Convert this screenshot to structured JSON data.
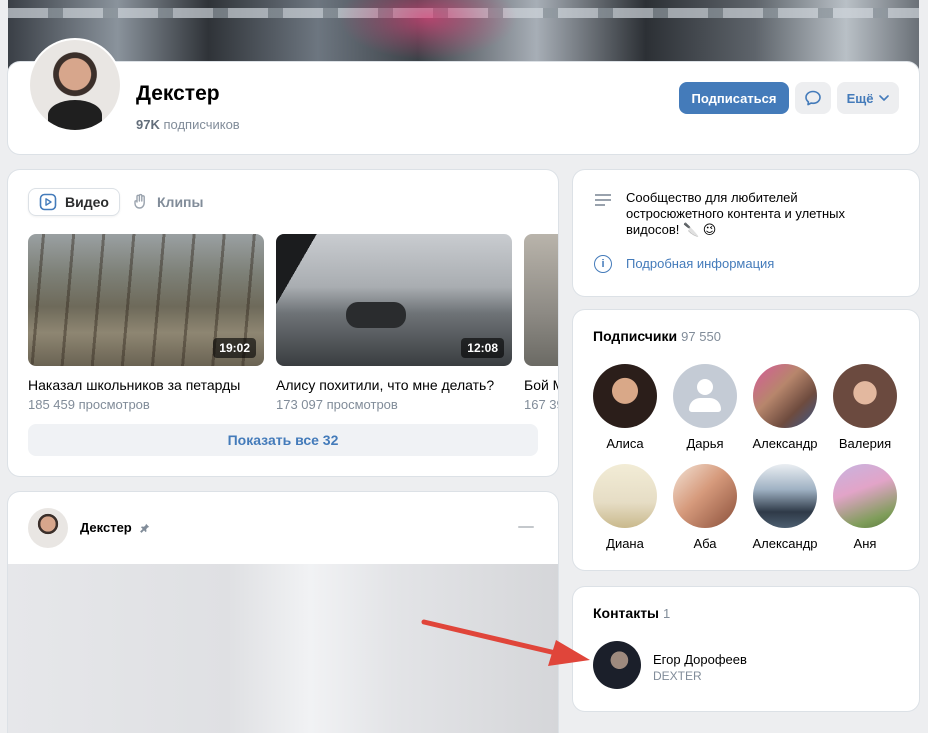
{
  "colors": {
    "accent": "#447bba",
    "secondary_text": "#818c99",
    "arrow": "#e0453a"
  },
  "header": {
    "group_name": "Декстер",
    "subscribers_short": "97K",
    "subscribers_word": "подписчиков",
    "subscribe_button": "Подписаться",
    "more_button": "Ещё"
  },
  "videos_block": {
    "tabs": [
      {
        "label": "Видео",
        "icon": "play-icon",
        "active": true
      },
      {
        "label": "Клипы",
        "icon": "clips-icon",
        "active": false
      }
    ],
    "items": [
      {
        "title": "Наказал школьников за петарды",
        "views": "185 459 просмотров",
        "duration": "19:02"
      },
      {
        "title": "Алису похитили, что мне делать?",
        "views": "173 097 просмотров",
        "duration": "12:08"
      },
      {
        "title": "Бой М",
        "views": "167 39",
        "duration": ""
      }
    ],
    "show_all": "Показать все 32"
  },
  "post": {
    "author": "Декстер",
    "pinned_icon": "pin-icon"
  },
  "description": {
    "text": "Сообщество для любителей остросюжетного контента и улетных видосов! 🔪 😉",
    "more_info_link": "Подробная информация"
  },
  "subscribers_block": {
    "title": "Подписчики",
    "count": "97 550",
    "people": [
      {
        "name": "Алиса",
        "color": "#5a3a3a"
      },
      {
        "name": "Дарья",
        "color": "generic"
      },
      {
        "name": "Александр",
        "color": "#7a4d5a"
      },
      {
        "name": "Валерия",
        "color": "#6b4a3f"
      },
      {
        "name": "Диана",
        "color": "#e6ddc5"
      },
      {
        "name": "Аба",
        "color": "#c98a6e"
      },
      {
        "name": "Александр",
        "color": "#4a5a6e"
      },
      {
        "name": "Аня",
        "color": "#b79ac2"
      }
    ]
  },
  "contacts_block": {
    "title": "Контакты",
    "count": "1",
    "person": {
      "name": "Егор Дорофеев",
      "role": "DEXTER"
    }
  }
}
